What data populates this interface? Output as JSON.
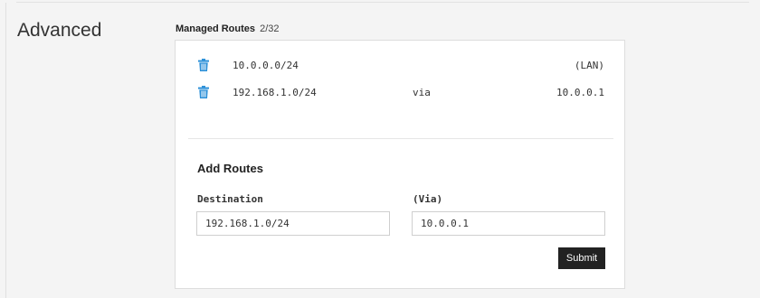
{
  "section": {
    "title": "Advanced"
  },
  "managed_routes": {
    "title": "Managed Routes",
    "count": "2/32",
    "routes": [
      {
        "destination": "10.0.0.0/24",
        "via_label": "",
        "target": "(LAN)",
        "delete_icon": "trash-icon"
      },
      {
        "destination": "192.168.1.0/24",
        "via_label": "via",
        "target": "10.0.0.1",
        "delete_icon": "trash-icon"
      }
    ]
  },
  "add_routes": {
    "title": "Add Routes",
    "destination_label": "Destination",
    "destination_value": "192.168.1.0/24",
    "via_label": "(Via)",
    "via_value": "10.0.0.1",
    "submit_label": "Submit"
  },
  "colors": {
    "icon_blue": "#2a8fd8",
    "button_bg": "#222222",
    "page_bg": "#f4f4f4",
    "card_bg": "#ffffff"
  }
}
